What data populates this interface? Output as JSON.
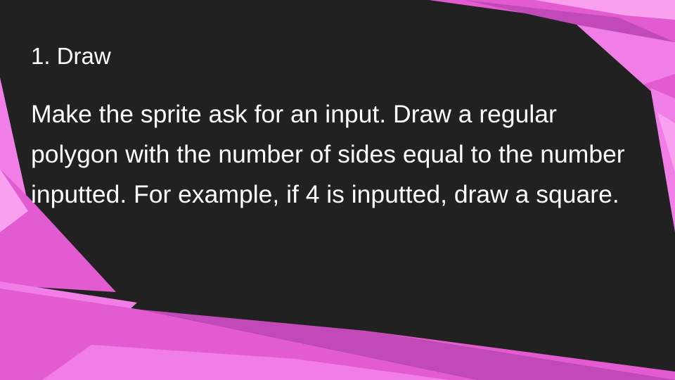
{
  "slide": {
    "heading": "1. Draw",
    "body": "Make the sprite ask for an input. Draw a regular polygon with the number of sides equal to the number inputted. For example, if 4 is inputted, draw a square."
  },
  "theme": {
    "background": "#212121",
    "accent_colors": [
      "#e35bd1",
      "#f07ee6",
      "#c24ab8",
      "#f9a0ef"
    ]
  }
}
